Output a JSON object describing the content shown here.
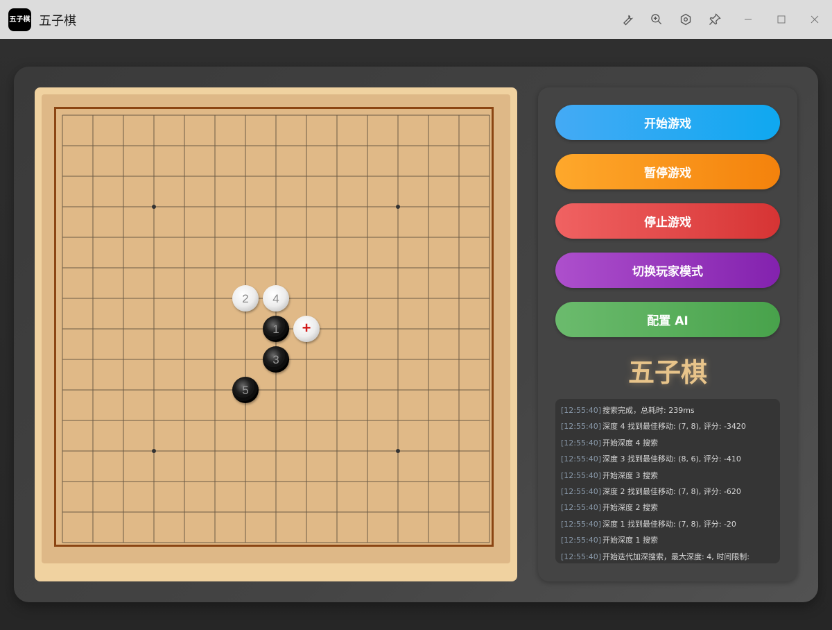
{
  "window": {
    "title": "五子棋",
    "icon_text": "五子棋"
  },
  "titlebar_icons": [
    "wrench-icon",
    "zoom-in-icon",
    "settings-hex-icon",
    "pin-icon",
    "minimize-icon",
    "maximize-icon",
    "close-icon"
  ],
  "controls": {
    "start": "开始游戏",
    "pause": "暂停游戏",
    "stop": "停止游戏",
    "switch_mode": "切换玩家模式",
    "config_ai": "配置 AI"
  },
  "colors": {
    "start": "#3aa8f2",
    "pause": "#f7941d",
    "stop": "#e04848",
    "switch_mode": "#9c3fbf",
    "config_ai": "#5cb25f",
    "board": "#deb887",
    "frame": "#8b4513"
  },
  "logo": "五子棋",
  "board": {
    "size": 15,
    "star_points": [
      [
        3,
        3
      ],
      [
        11,
        3
      ],
      [
        3,
        11
      ],
      [
        11,
        11
      ]
    ],
    "stones": [
      {
        "col": 7,
        "row": 7,
        "color": "black",
        "label": "1"
      },
      {
        "col": 6,
        "row": 6,
        "color": "white",
        "label": "2"
      },
      {
        "col": 7,
        "row": 8,
        "color": "black",
        "label": "3"
      },
      {
        "col": 7,
        "row": 6,
        "color": "white",
        "label": "4"
      },
      {
        "col": 6,
        "row": 9,
        "color": "black",
        "label": "5"
      },
      {
        "col": 8,
        "row": 7,
        "color": "white",
        "label": "+"
      }
    ]
  },
  "log": [
    {
      "time": "[12:55:40]",
      "msg": "搜索完成，总耗时: 239ms"
    },
    {
      "time": "[12:55:40]",
      "msg": "深度 4 找到最佳移动: (7, 8), 评分: -3420"
    },
    {
      "time": "[12:55:40]",
      "msg": "开始深度 4 搜索"
    },
    {
      "time": "[12:55:40]",
      "msg": "深度 3 找到最佳移动: (8, 6), 评分: -410"
    },
    {
      "time": "[12:55:40]",
      "msg": "开始深度 3 搜索"
    },
    {
      "time": "[12:55:40]",
      "msg": "深度 2 找到最佳移动: (7, 8), 评分: -620"
    },
    {
      "time": "[12:55:40]",
      "msg": "开始深度 2 搜索"
    },
    {
      "time": "[12:55:40]",
      "msg": "深度 1 找到最佳移动: (7, 8), 评分: -20"
    },
    {
      "time": "[12:55:40]",
      "msg": "开始深度 1 搜索"
    },
    {
      "time": "[12:55:40]",
      "msg": "开始迭代加深搜索，最大深度: 4, 时间限制:"
    }
  ]
}
